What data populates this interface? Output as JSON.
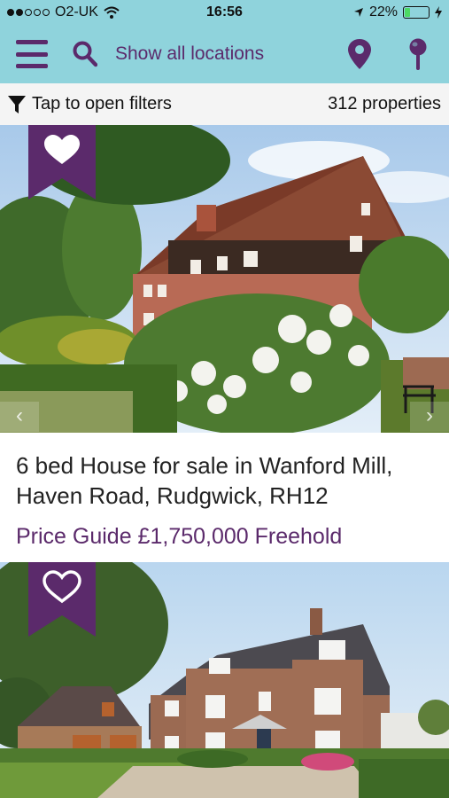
{
  "status_bar": {
    "carrier": "O2-UK",
    "time": "16:56",
    "battery": "22%",
    "battery_level": 0.22,
    "signal_bars_filled": 2,
    "signal_bars_total": 5
  },
  "header": {
    "menu_icon": "hamburger-menu-icon",
    "search_icon": "search-icon",
    "search_label": "Show all locations",
    "location_icon": "map-pin-icon",
    "pin_icon": "drop-pin-icon"
  },
  "filter_bar": {
    "filter_icon": "funnel-icon",
    "filter_label": "Tap to open filters",
    "count_label": "312 properties"
  },
  "listings": [
    {
      "title": "6 bed House for sale in Wanford Mill, Haven Road, Rudgwick, RH12",
      "price": "Price Guide £1,750,000 Freehold",
      "favorite": true,
      "prev_label": "‹",
      "next_label": "›"
    },
    {
      "title": "",
      "price": "",
      "favorite": false
    }
  ],
  "colors": {
    "header_bg": "#8fd3dc",
    "brand_purple": "#5b2a6b",
    "filter_bg": "#f4f4f4"
  }
}
